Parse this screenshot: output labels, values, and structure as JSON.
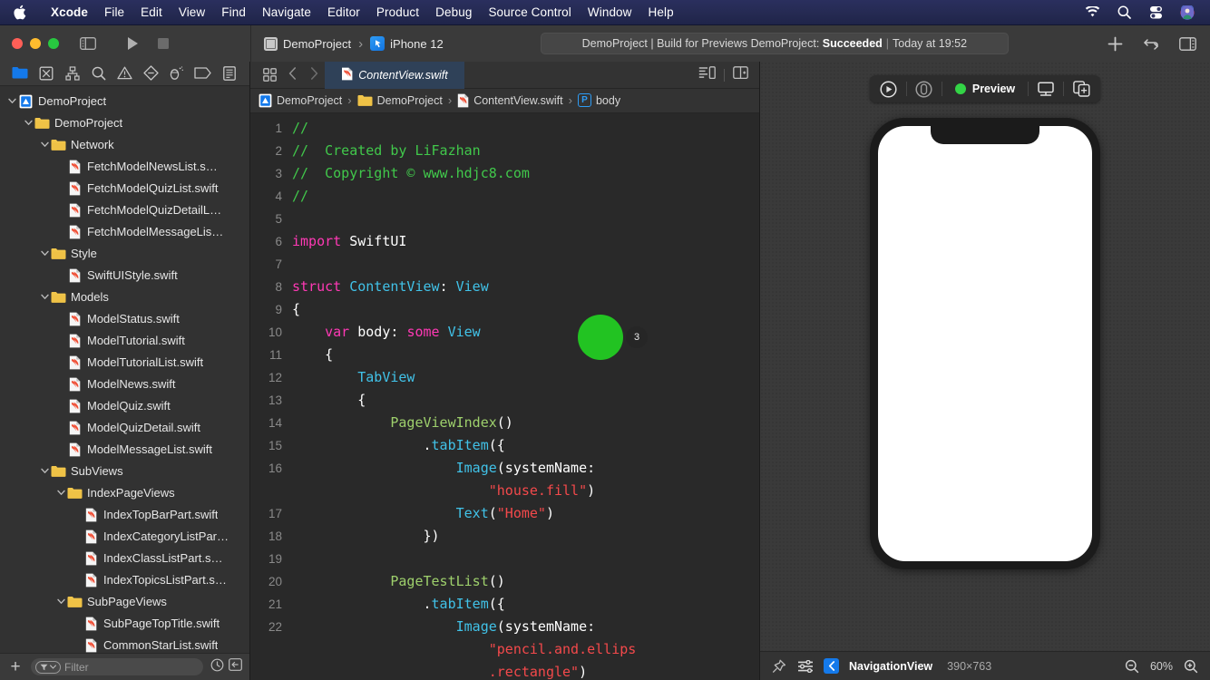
{
  "menubar": {
    "apple_icon": "apple-logo-icon",
    "items": [
      {
        "label": "Xcode",
        "bold": true
      },
      {
        "label": "File",
        "bold": false
      },
      {
        "label": "Edit",
        "bold": false
      },
      {
        "label": "View",
        "bold": false
      },
      {
        "label": "Find",
        "bold": false
      },
      {
        "label": "Navigate",
        "bold": false
      },
      {
        "label": "Editor",
        "bold": false
      },
      {
        "label": "Product",
        "bold": false
      },
      {
        "label": "Debug",
        "bold": false
      },
      {
        "label": "Source Control",
        "bold": false
      },
      {
        "label": "Window",
        "bold": false
      },
      {
        "label": "Help",
        "bold": false
      }
    ],
    "status_icons": [
      "wifi-icon",
      "search-icon",
      "control-center-icon",
      "user-avatar-icon"
    ]
  },
  "toolbar": {
    "traffic_lights": [
      "close-button",
      "minimize-button",
      "zoom-button"
    ],
    "sidebar_toggle": "sidebar-toggle-icon",
    "run_button": "run-icon",
    "stop_button": "stop-icon",
    "scheme": {
      "project": "DemoProject",
      "separator": "›",
      "destination": "iPhone 12"
    },
    "status": {
      "prefix": "DemoProject | Build for Previews DemoProject:",
      "result": "Succeeded",
      "separator": "|",
      "time": "Today at 19:52"
    },
    "actions": [
      "add-icon",
      "code-review-icon",
      "inspector-toggle-icon"
    ]
  },
  "navigator": {
    "tabs": [
      "project-navigator-icon",
      "source-control-navigator-icon",
      "symbol-navigator-icon",
      "find-navigator-icon",
      "issue-navigator-icon",
      "test-navigator-icon",
      "debug-navigator-icon",
      "breakpoint-navigator-icon",
      "report-navigator-icon"
    ],
    "selected_tab": 0,
    "tree": [
      {
        "label": "DemoProject",
        "type": "project",
        "depth": 0,
        "expanded": true
      },
      {
        "label": "DemoProject",
        "type": "folder",
        "depth": 1,
        "expanded": true
      },
      {
        "label": "Network",
        "type": "folder",
        "depth": 2,
        "expanded": true
      },
      {
        "label": "FetchModelNewsList.s…",
        "type": "swift",
        "depth": 3,
        "expanded": null
      },
      {
        "label": "FetchModelQuizList.swift",
        "type": "swift",
        "depth": 3,
        "expanded": null
      },
      {
        "label": "FetchModelQuizDetailL…",
        "type": "swift",
        "depth": 3,
        "expanded": null
      },
      {
        "label": "FetchModelMessageLis…",
        "type": "swift",
        "depth": 3,
        "expanded": null
      },
      {
        "label": "Style",
        "type": "folder",
        "depth": 2,
        "expanded": true
      },
      {
        "label": "SwiftUIStyle.swift",
        "type": "swift",
        "depth": 3,
        "expanded": null
      },
      {
        "label": "Models",
        "type": "folder",
        "depth": 2,
        "expanded": true
      },
      {
        "label": "ModelStatus.swift",
        "type": "swift",
        "depth": 3,
        "expanded": null
      },
      {
        "label": "ModelTutorial.swift",
        "type": "swift",
        "depth": 3,
        "expanded": null
      },
      {
        "label": "ModelTutorialList.swift",
        "type": "swift",
        "depth": 3,
        "expanded": null
      },
      {
        "label": "ModelNews.swift",
        "type": "swift",
        "depth": 3,
        "expanded": null
      },
      {
        "label": "ModelQuiz.swift",
        "type": "swift",
        "depth": 3,
        "expanded": null
      },
      {
        "label": "ModelQuizDetail.swift",
        "type": "swift",
        "depth": 3,
        "expanded": null
      },
      {
        "label": "ModelMessageList.swift",
        "type": "swift",
        "depth": 3,
        "expanded": null
      },
      {
        "label": "SubViews",
        "type": "folder",
        "depth": 2,
        "expanded": true
      },
      {
        "label": "IndexPageViews",
        "type": "folder",
        "depth": 3,
        "expanded": true
      },
      {
        "label": "IndexTopBarPart.swift",
        "type": "swift",
        "depth": 4,
        "expanded": null
      },
      {
        "label": "IndexCategoryListPar…",
        "type": "swift",
        "depth": 4,
        "expanded": null
      },
      {
        "label": "IndexClassListPart.s…",
        "type": "swift",
        "depth": 4,
        "expanded": null
      },
      {
        "label": "IndexTopicsListPart.s…",
        "type": "swift",
        "depth": 4,
        "expanded": null
      },
      {
        "label": "SubPageViews",
        "type": "folder",
        "depth": 3,
        "expanded": true
      },
      {
        "label": "SubPageTopTitle.swift",
        "type": "swift",
        "depth": 4,
        "expanded": null
      },
      {
        "label": "CommonStarList.swift",
        "type": "swift",
        "depth": 4,
        "expanded": null
      }
    ],
    "filter": {
      "add_label": "+",
      "placeholder": "Filter",
      "recent_icon": "clock-icon",
      "collapse_icon": "collapse-icon"
    }
  },
  "editor": {
    "tab_icons": [
      "related-items-icon",
      "back-arrow-icon",
      "forward-arrow-icon"
    ],
    "tab_label": "ContentView.swift",
    "breadcrumbs": [
      {
        "label": "DemoProject",
        "type": "project"
      },
      {
        "label": "DemoProject",
        "type": "folder"
      },
      {
        "label": "ContentView.swift",
        "type": "swift"
      },
      {
        "label": "body",
        "type": "property"
      }
    ],
    "right_icons": [
      "minimap-icon",
      "split-editor-icon"
    ],
    "blame_badge": "3",
    "code_lines": [
      {
        "num": "1",
        "tokens": [
          {
            "t": "//",
            "c": "c-comment"
          }
        ]
      },
      {
        "num": "2",
        "tokens": [
          {
            "t": "//  Created by LiFazhan",
            "c": "c-comment"
          }
        ]
      },
      {
        "num": "3",
        "tokens": [
          {
            "t": "//  Copyright © www.hdjc8.com",
            "c": "c-comment"
          }
        ]
      },
      {
        "num": "4",
        "tokens": [
          {
            "t": "//",
            "c": "c-comment"
          }
        ]
      },
      {
        "num": "5",
        "tokens": [
          {
            "t": "",
            "c": "ctext"
          }
        ]
      },
      {
        "num": "6",
        "tokens": [
          {
            "t": "import",
            "c": "c-keyword"
          },
          {
            "t": " SwiftUI",
            "c": "c-plain"
          }
        ]
      },
      {
        "num": "7",
        "tokens": [
          {
            "t": "",
            "c": "ctext"
          }
        ]
      },
      {
        "num": "8",
        "tokens": [
          {
            "t": "struct",
            "c": "c-keyword"
          },
          {
            "t": " ",
            "c": "c-plain"
          },
          {
            "t": "ContentView",
            "c": "c-type"
          },
          {
            "t": ": ",
            "c": "c-plain"
          },
          {
            "t": "View",
            "c": "c-type"
          }
        ]
      },
      {
        "num": "9",
        "tokens": [
          {
            "t": "{",
            "c": "c-plain"
          }
        ]
      },
      {
        "num": "10",
        "tokens": [
          {
            "t": "    ",
            "c": "c-plain"
          },
          {
            "t": "var",
            "c": "c-keyword"
          },
          {
            "t": " body: ",
            "c": "c-plain"
          },
          {
            "t": "some",
            "c": "c-keyword"
          },
          {
            "t": " ",
            "c": "c-plain"
          },
          {
            "t": "View",
            "c": "c-type"
          }
        ]
      },
      {
        "num": "11",
        "tokens": [
          {
            "t": "    {",
            "c": "c-plain"
          }
        ]
      },
      {
        "num": "12",
        "tokens": [
          {
            "t": "        ",
            "c": "c-plain"
          },
          {
            "t": "TabView",
            "c": "c-type"
          }
        ]
      },
      {
        "num": "13",
        "tokens": [
          {
            "t": "        {",
            "c": "c-plain"
          }
        ]
      },
      {
        "num": "14",
        "tokens": [
          {
            "t": "            ",
            "c": "c-plain"
          },
          {
            "t": "PageViewIndex",
            "c": "c-proj"
          },
          {
            "t": "()",
            "c": "c-plain"
          }
        ]
      },
      {
        "num": "15",
        "tokens": [
          {
            "t": "                .",
            "c": "c-plain"
          },
          {
            "t": "tabItem",
            "c": "c-type"
          },
          {
            "t": "({",
            "c": "c-plain"
          }
        ]
      },
      {
        "num": "16",
        "tokens": [
          {
            "t": "                    ",
            "c": "c-plain"
          },
          {
            "t": "Image",
            "c": "c-type"
          },
          {
            "t": "(systemName:",
            "c": "c-plain"
          }
        ],
        "wrap": [
          {
            "t": "                        ",
            "c": "c-plain"
          },
          {
            "t": "\"house.fill\"",
            "c": "c-string"
          },
          {
            "t": ")",
            "c": "c-plain"
          }
        ]
      },
      {
        "num": "17",
        "tokens": [
          {
            "t": "                    ",
            "c": "c-plain"
          },
          {
            "t": "Text",
            "c": "c-type"
          },
          {
            "t": "(",
            "c": "c-plain"
          },
          {
            "t": "\"Home\"",
            "c": "c-string"
          },
          {
            "t": ")",
            "c": "c-plain"
          }
        ]
      },
      {
        "num": "18",
        "tokens": [
          {
            "t": "                })",
            "c": "c-plain"
          }
        ]
      },
      {
        "num": "19",
        "tokens": [
          {
            "t": "",
            "c": "ctext"
          }
        ]
      },
      {
        "num": "20",
        "tokens": [
          {
            "t": "            ",
            "c": "c-plain"
          },
          {
            "t": "PageTestList",
            "c": "c-proj"
          },
          {
            "t": "()",
            "c": "c-plain"
          }
        ]
      },
      {
        "num": "21",
        "tokens": [
          {
            "t": "                .",
            "c": "c-plain"
          },
          {
            "t": "tabItem",
            "c": "c-type"
          },
          {
            "t": "({",
            "c": "c-plain"
          }
        ]
      },
      {
        "num": "22",
        "tokens": [
          {
            "t": "                    ",
            "c": "c-plain"
          },
          {
            "t": "Image",
            "c": "c-type"
          },
          {
            "t": "(systemName:",
            "c": "c-plain"
          }
        ],
        "wrap": [
          {
            "t": "                        ",
            "c": "c-plain"
          },
          {
            "t": "\"pencil.and.ellips",
            "c": "c-string"
          }
        ],
        "wrap2": [
          {
            "t": "                        ",
            "c": "c-plain"
          },
          {
            "t": ".rectangle\"",
            "c": "c-string"
          },
          {
            "t": ")",
            "c": "c-plain"
          }
        ]
      }
    ]
  },
  "canvas": {
    "toolbar": {
      "play_icon": "live-preview-icon",
      "inspect_icon": "inspect-preview-icon",
      "status_label": "Preview",
      "status_color": "#33d446",
      "device_icon": "device-settings-icon",
      "duplicate_icon": "duplicate-preview-icon"
    },
    "device": {
      "name": "iPhone 12"
    },
    "bottom_bar": {
      "pin_icon": "pin-icon",
      "variants_icon": "variants-icon",
      "back_icon": "back-chevron-icon",
      "title": "NavigationView",
      "dimensions": "390×763",
      "zoom_out_icon": "zoom-out-icon",
      "zoom_level": "60%",
      "zoom_in_icon": "zoom-in-icon"
    }
  },
  "colors": {
    "menubar_bg": "#252a52",
    "toolbar_bg": "#3a3a3a",
    "navigator_bg": "#323232",
    "editor_bg": "#292929",
    "canvas_bg": "#3a3a3a",
    "tab_active_bg": "#2f4158",
    "accent_blue": "#1479ea",
    "comment_green": "#41c84b",
    "keyword_pink": "#ff39b5",
    "type_cyan": "#41c2e8",
    "project_green": "#9ed06c",
    "string_red": "#f4494b"
  }
}
